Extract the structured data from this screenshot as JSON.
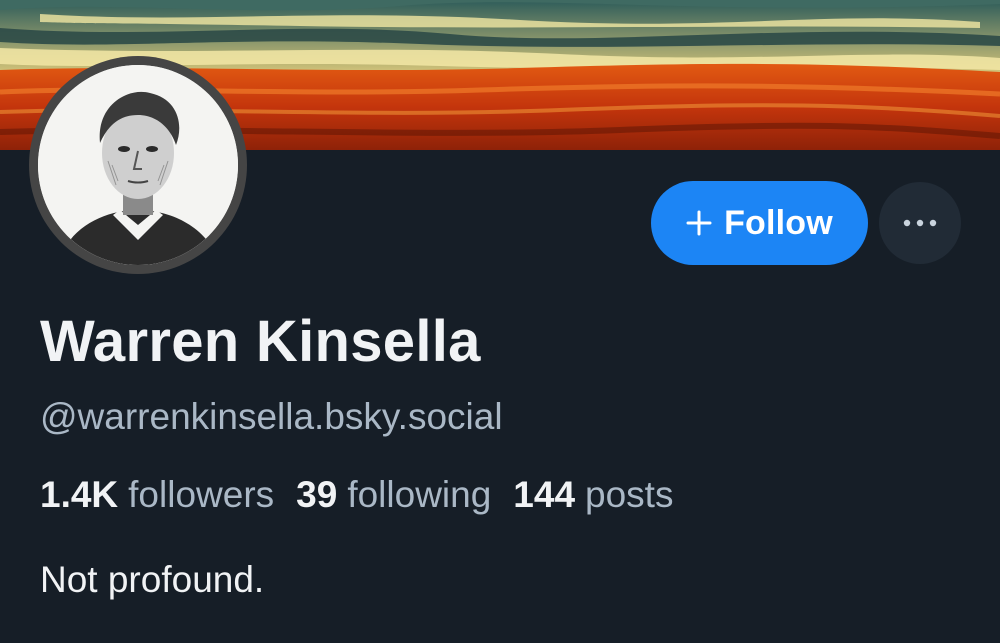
{
  "profile": {
    "display_name": "Warren Kinsella",
    "handle": "@warrenkinsella.bsky.social",
    "bio": "Not profound."
  },
  "actions": {
    "follow_label": "Follow",
    "follow_icon": "plus-icon",
    "more_icon": "ellipsis-icon"
  },
  "stats": {
    "followers_count": "1.4K",
    "followers_label": "followers",
    "following_count": "39",
    "following_label": "following",
    "posts_count": "144",
    "posts_label": "posts"
  },
  "colors": {
    "background": "#161e27",
    "accent": "#1c85f5",
    "secondary_text": "#aab8c6",
    "primary_text": "#f1f3f5"
  }
}
